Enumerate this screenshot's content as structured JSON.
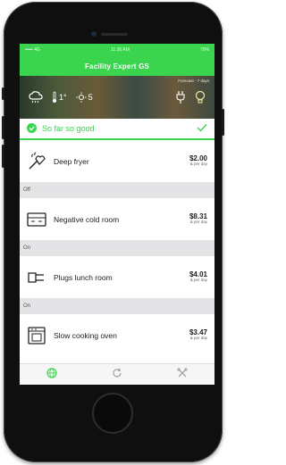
{
  "status_bar": {
    "carrier": "••••• 4G",
    "time": "11:30 AM",
    "battery": "70%"
  },
  "header": {
    "title": "Facility Expert GS"
  },
  "weather": {
    "caption": "Forecast - 7 days",
    "temperature": "1°",
    "hot_value": "5",
    "icons": [
      "cloud-rain-icon",
      "thermometer-icon",
      "hot-icon",
      "plug-icon",
      "bulb-icon"
    ]
  },
  "status": {
    "text": "So far so good",
    "accent": "#3bd44f"
  },
  "devices": [
    {
      "name": "Deep fryer",
      "amount": "$2.00",
      "period": "& per day",
      "group": "Off",
      "icon": "deep-fryer-icon"
    },
    {
      "name": "Negative cold room",
      "amount": "$8.31",
      "period": "& per day",
      "group": "On",
      "icon": "cold-room-icon"
    },
    {
      "name": "Plugs lunch room",
      "amount": "$4.01",
      "period": "& per day",
      "group": "On",
      "icon": "plug-icon"
    },
    {
      "name": "Slow cooking oven",
      "amount": "$3.47",
      "period": "& per day",
      "group": "",
      "icon": "oven-icon"
    }
  ],
  "tabs": [
    {
      "name": "dashboard",
      "icon": "globe-icon",
      "active": true
    },
    {
      "name": "refresh",
      "icon": "refresh-icon",
      "active": false
    },
    {
      "name": "settings",
      "icon": "tools-icon",
      "active": false
    }
  ]
}
